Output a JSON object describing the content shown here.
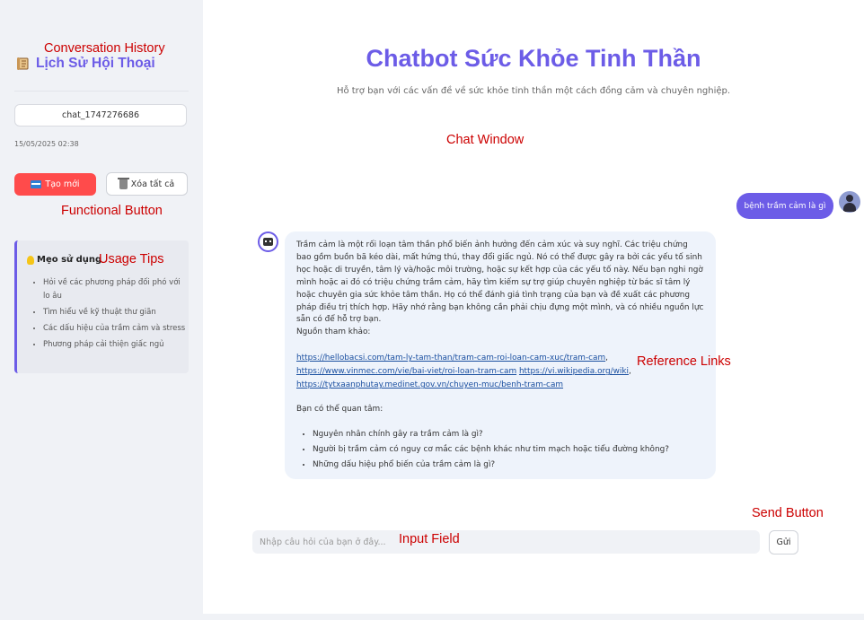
{
  "annotations": {
    "conversation_history": "Conversation History",
    "functional_button": "Functional Button",
    "usage_tips": "Usage Tips",
    "chat_window": "Chat Window",
    "reference_links": "Reference Links",
    "send_button": "Send Button",
    "input_field": "Input Field"
  },
  "sidebar": {
    "icon": "scroll-icon",
    "title": "Lịch Sử Hội Thoại",
    "chat_item": "chat_1747276686",
    "chat_date": "15/05/2025 02:38",
    "new_button": "Tạo mới",
    "clear_button": "Xóa tất cả",
    "tips": {
      "title": "Mẹo sử dụng",
      "items": [
        "Hỏi về các phương pháp đối phó với lo âu",
        "Tìm hiểu về kỹ thuật thư giãn",
        "Các dấu hiệu của trầm cảm và stress",
        "Phương pháp cải thiện giấc ngủ"
      ]
    }
  },
  "header": {
    "title": "Chatbot Sức Khỏe Tinh Thần",
    "subtitle": "Hỗ trợ bạn với các vấn đề về sức khỏe tinh thần một cách đồng cảm và chuyên nghiệp."
  },
  "chat": {
    "user_message": "bệnh trầm cảm là gì",
    "bot_message": "Trầm cảm là một rối loạn tâm thần phổ biến ảnh hưởng đến cảm xúc và suy nghĩ. Các triệu chứng bao gồm buồn bã kéo dài, mất hứng thú, thay đổi giấc ngủ. Nó có thể được gây ra bởi các yếu tố sinh học hoặc di truyền, tâm lý và/hoặc môi trường, hoặc sự kết hợp của các yếu tố này. Nếu bạn nghi ngờ mình hoặc ai đó có triệu chứng trầm cảm, hãy tìm kiếm sự trợ giúp chuyên nghiệp từ bác sĩ tâm lý hoặc chuyên gia sức khỏe tâm thần. Họ có thể đánh giá tình trạng của bạn và đề xuất các phương pháp điều trị thích hợp. Hãy nhớ rằng bạn không cần phải chịu đựng một mình, và có nhiều nguồn lực sẵn có để hỗ trợ bạn.",
    "sources_label": "Nguồn tham khảo:",
    "links": [
      "https://hellobacsi.com/tam-ly-tam-than/tram-cam-roi-loan-cam-xuc/tram-cam",
      "https://www.vinmec.com/vie/bai-viet/roi-loan-tram-cam",
      "https://vi.wikipedia.org/wiki",
      "https://tytxaanphutay.medinet.gov.vn/chuyen-muc/benh-tram-cam"
    ],
    "related_label": "Bạn có thể quan tâm:",
    "related": [
      "Nguyên nhân chính gây ra trầm cảm là gì?",
      "Người bị trầm cảm có nguy cơ mắc các bệnh khác như tim mạch hoặc tiểu đường không?",
      "Những dấu hiệu phổ biến của trầm cảm là gì?"
    ]
  },
  "input": {
    "placeholder": "Nhập câu hỏi của bạn ở đây...",
    "send_label": "Gửi"
  }
}
